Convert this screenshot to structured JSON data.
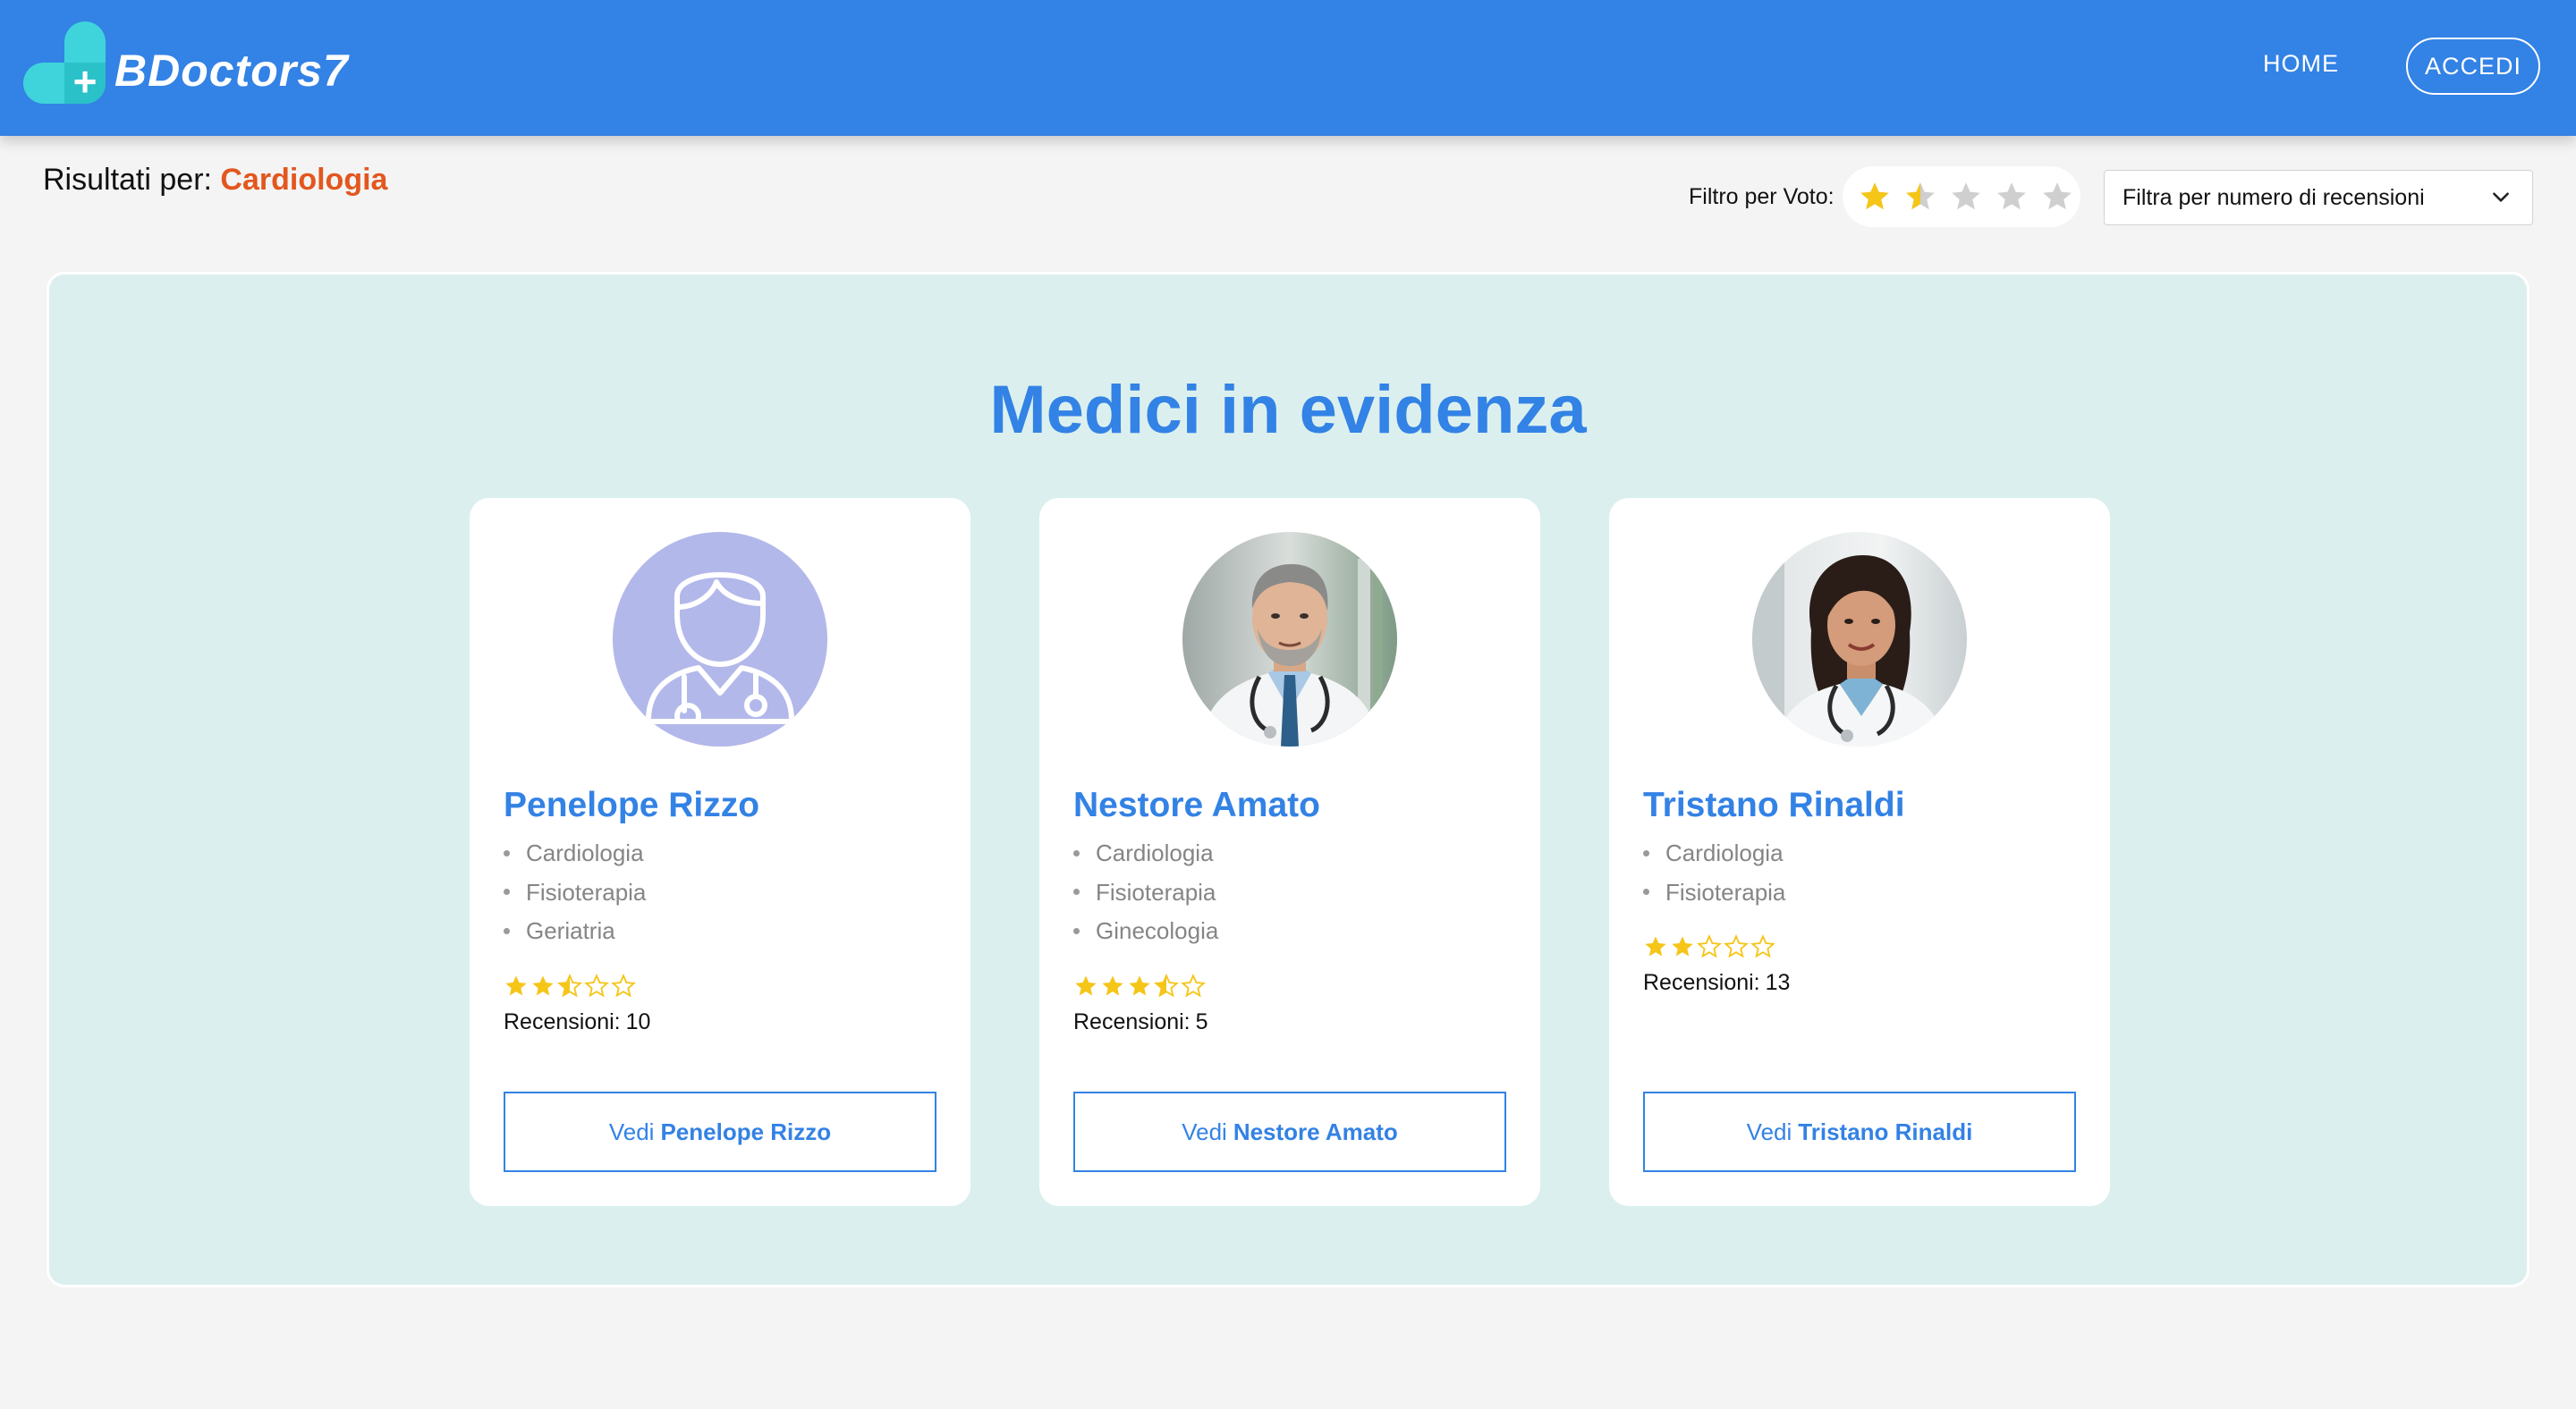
{
  "navbar": {
    "brand": "BDoctors7",
    "home_label": "HOME",
    "login_label": "ACCEDI",
    "color": "#3382e5"
  },
  "results": {
    "prefix": "Risultati per:",
    "query": "Cardiologia"
  },
  "filters": {
    "rating_label": "Filtro per Voto:",
    "rating_value": 1.5,
    "rating_max": 5,
    "reviews_select_placeholder": "Filtra per numero di recensioni"
  },
  "featured": {
    "title": "Medici in evidenza",
    "doctors": [
      {
        "name": "Penelope Rizzo",
        "avatar": "doctor-placeholder-icon",
        "specializations": [
          "Cardiologia",
          "Fisioterapia",
          "Geriatria"
        ],
        "rating": 2.5,
        "reviews_label": "Recensioni:",
        "reviews_count": "10",
        "button_prefix": "Vedi"
      },
      {
        "name": "Nestore Amato",
        "avatar": "doctor-photo-male",
        "specializations": [
          "Cardiologia",
          "Fisioterapia",
          "Ginecologia"
        ],
        "rating": 3.5,
        "reviews_label": "Recensioni:",
        "reviews_count": "5",
        "button_prefix": "Vedi"
      },
      {
        "name": "Tristano Rinaldi",
        "avatar": "doctor-photo-female",
        "specializations": [
          "Cardiologia",
          "Fisioterapia"
        ],
        "rating": 2,
        "reviews_label": "Recensioni:",
        "reviews_count": "13",
        "button_prefix": "Vedi"
      }
    ]
  },
  "colors": {
    "accent": "#3382e5",
    "query": "#e2571f",
    "star": "#f5c518",
    "panel_bg": "#dbf0ee"
  }
}
